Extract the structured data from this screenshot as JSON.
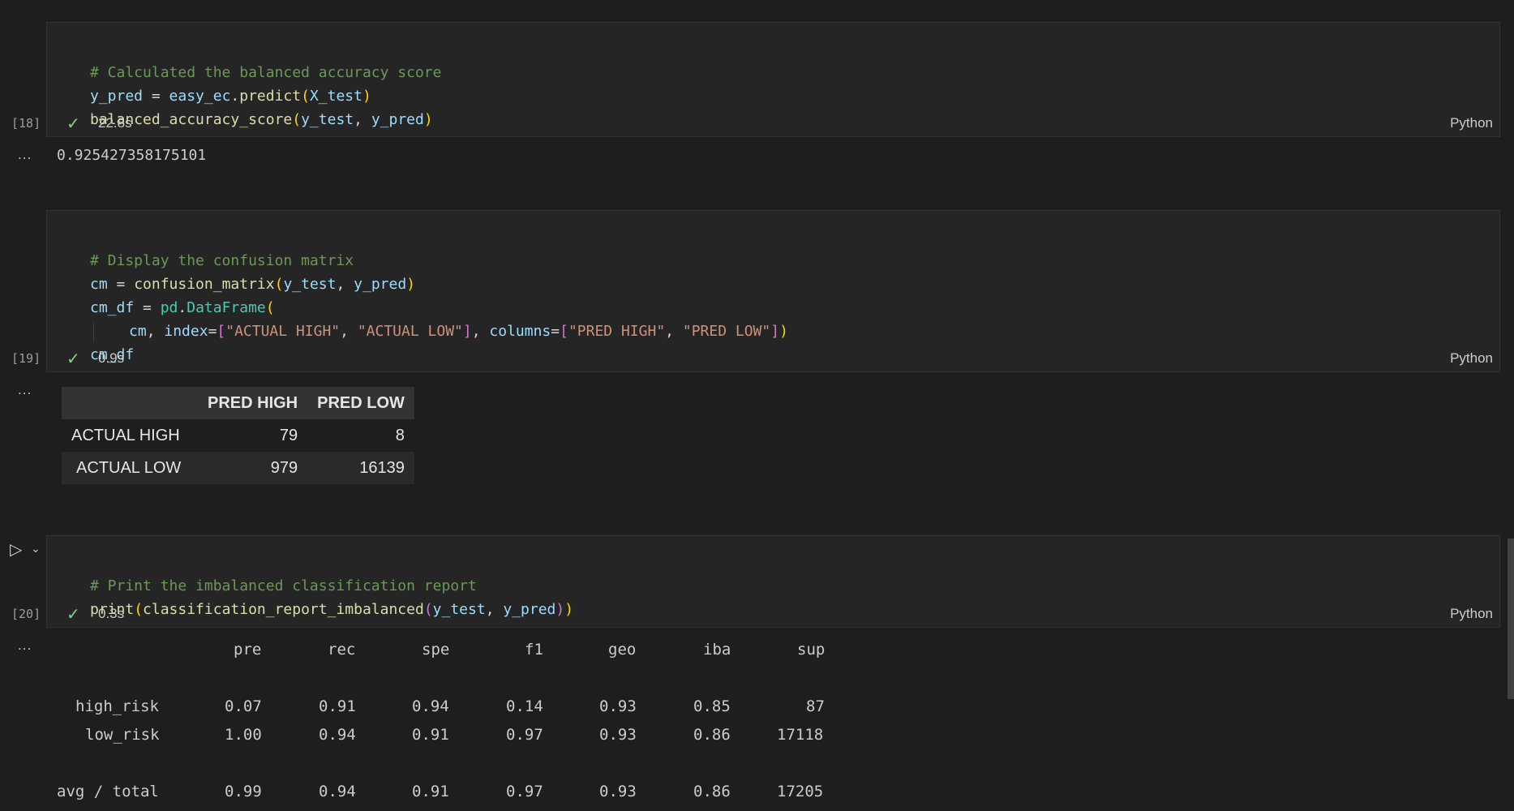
{
  "cells": [
    {
      "exec_count": "[18]",
      "code": {
        "comment": "# Calculated the balanced accuracy score",
        "line2": {
          "var": "y_pred",
          "eq": " = ",
          "obj": "easy_ec",
          "dot": ".",
          "fn": "predict",
          "open": "(",
          "arg": "X_test",
          "close": ")"
        },
        "line3": {
          "fn": "balanced_accuracy_score",
          "open": "(",
          "arg1": "y_test",
          "sep": ", ",
          "arg2": "y_pred",
          "close": ")"
        }
      },
      "status_time": "22.8s",
      "language": "Python",
      "output": "0.925427358175101"
    },
    {
      "exec_count": "[19]",
      "code": {
        "comment": "# Display the confusion matrix",
        "line2": {
          "var": "cm",
          "eq": " = ",
          "fn": "confusion_matrix",
          "open": "(",
          "arg1": "y_test",
          "sep": ", ",
          "arg2": "y_pred",
          "close": ")"
        },
        "line3": {
          "var": "cm_df",
          "eq": " = ",
          "obj": "pd",
          "dot": ".",
          "cls": "DataFrame",
          "open": "("
        },
        "line4": {
          "arg": "cm",
          "sep1": ", ",
          "kw1": "index",
          "eq1": "=",
          "ob1": "[",
          "s1": "\"ACTUAL HIGH\"",
          "sep2": ", ",
          "s2": "\"ACTUAL LOW\"",
          "cb1": "]",
          "sep3": ", ",
          "kw2": "columns",
          "eq2": "=",
          "ob2": "[",
          "s3": "\"PRED HIGH\"",
          "sep4": ", ",
          "s4": "\"PRED LOW\"",
          "cb2": "]",
          "close": ")"
        },
        "line5": {
          "var": "cm_df"
        }
      },
      "status_time": "0.9s",
      "language": "Python",
      "output_table": {
        "columns": [
          "",
          "PRED HIGH",
          "PRED LOW"
        ],
        "rows": [
          {
            "index": "ACTUAL HIGH",
            "values": [
              "79",
              "8"
            ]
          },
          {
            "index": "ACTUAL LOW",
            "values": [
              "979",
              "16139"
            ]
          }
        ]
      }
    },
    {
      "exec_count": "[20]",
      "code": {
        "comment": "# Print the imbalanced classification report",
        "line2": {
          "fn": "print",
          "open1": "(",
          "fn2": "classification_report_imbalanced",
          "open2": "(",
          "arg1": "y_test",
          "sep": ", ",
          "arg2": "y_pred",
          "close2": ")",
          "close1": ")"
        }
      },
      "status_time": "0.3s",
      "language": "Python",
      "report": {
        "headers": [
          "pre",
          "rec",
          "spe",
          "f1",
          "geo",
          "iba",
          "sup"
        ],
        "rows": [
          {
            "label": "high_risk",
            "values": [
              "0.07",
              "0.91",
              "0.94",
              "0.14",
              "0.93",
              "0.85",
              "87"
            ]
          },
          {
            "label": "low_risk",
            "values": [
              "1.00",
              "0.94",
              "0.91",
              "0.97",
              "0.93",
              "0.86",
              "17118"
            ]
          },
          {
            "label": "avg / total",
            "values": [
              "0.99",
              "0.94",
              "0.91",
              "0.97",
              "0.93",
              "0.86",
              "17205"
            ]
          }
        ]
      }
    }
  ],
  "ui": {
    "output_dots": "...",
    "check_icon": "✓",
    "run_icon": "▷",
    "chevron_icon": "⌄"
  },
  "colors": {
    "background": "#1e1e1e",
    "cell_background": "#252526",
    "comment": "#6a9955",
    "variable": "#9cdcfe",
    "function": "#dcdcaa",
    "string": "#ce9178",
    "class": "#4ec9b0",
    "success": "#89d185"
  }
}
